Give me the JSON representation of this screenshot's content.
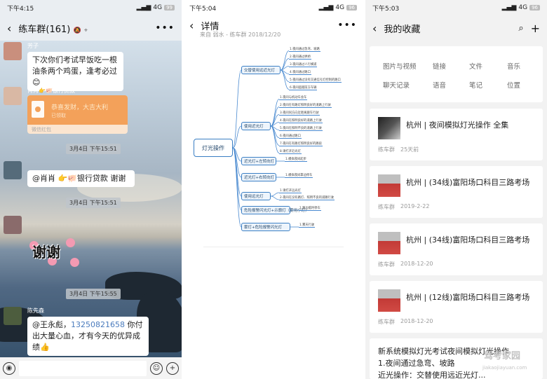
{
  "chat": {
    "status_time": "下午4:15",
    "network": "4G",
    "battery": "99",
    "title": "练车群(161)",
    "messages": [
      {
        "sender": "芳子",
        "text": "下次你们考试早饭吃一根油条两个鸡蛋，逢考必过😊"
      },
      {
        "sender": "肖肖👉🐖银行贷款",
        "red_packet_title": "恭喜发财，大吉大利",
        "red_packet_status": "已领取",
        "red_packet_label": "微信红包"
      },
      {
        "timestamp": "3月4日 下午15:51"
      },
      {
        "sender": "",
        "text": "@肖肖 👉🐖银行贷款  谢谢"
      },
      {
        "timestamp": "3月4日 下午15:51"
      },
      {
        "sender": "",
        "sticker_text": "谢谢"
      },
      {
        "timestamp": "3月4日 下午15:55"
      },
      {
        "sender": "陈先森",
        "mention": "@王永彪，",
        "phone": "13250821658",
        "text": " 你付出大量心血，才有今天的优异成绩👍"
      }
    ],
    "mute_icon": "mute-icon",
    "location_icon": "location-icon"
  },
  "detail": {
    "status_time": "下午5:04",
    "network": "4G",
    "battery": "96",
    "title": "详情",
    "source": "来自 弱水 - 练车群 2018/12/20",
    "mindmap": {
      "root": "灯光操作",
      "branches": [
        {
          "label": "交替使用远近光灯",
          "leaves": [
            "1.夜间通过急弯、坡路",
            "2.夜间通过拱桥",
            "3.夜间通过人行横道",
            "4.夜间通过路口",
            "5.夜间通过没有交通信号灯控制的路口",
            "6.夜间超越前方车辆"
          ]
        },
        {
          "label": "使用近光灯",
          "leaves": [
            "1.夜间与机动车会车",
            "2.夜间在有路灯照明良好的道路上行驶",
            "3.夜间同方向近距离跟车行驶",
            "4.夜间在照明良好的道路上行驶",
            "5.夜间在照明不良的道路上行驶",
            "6.夜间通过路口",
            "7.夜间在有路灯照明良好的路段",
            "8.请打开近光灯"
          ]
        },
        {
          "label": "近光灯+左转向灯",
          "leaves": [
            "1.模拟夜间起步"
          ]
        },
        {
          "label": "近光灯+右转向灯",
          "leaves": [
            "1.模拟夜间靠边停车"
          ]
        },
        {
          "label": "使用远光灯",
          "leaves": [
            "1.请打开远光灯",
            "2.夜间在没有路灯、照明不良的道路行驶"
          ]
        },
        {
          "label": "危险报警闪光灯+示廓灯（雾用小灯）",
          "leaves": [
            "1.路边临时停车"
          ]
        },
        {
          "label": "雾灯+危险报警闪光灯",
          "leaves": [
            "1.雾天行驶"
          ]
        }
      ]
    }
  },
  "favorites": {
    "status_time": "下午5:03",
    "network": "4G",
    "battery": "96",
    "title": "我的收藏",
    "categories": [
      "图片与视频",
      "链接",
      "文件",
      "音乐",
      "聊天记录",
      "语音",
      "笔记",
      "位置"
    ],
    "items": [
      {
        "title": "杭州 | 夜间模拟灯光操作 全集",
        "source": "练车群",
        "date": "25天前"
      },
      {
        "title": "杭州 | (34线)富阳场口科目三路考场",
        "source": "练车群",
        "date": "2019-2-22"
      },
      {
        "title": "杭州 | (34线)富阳场口科目三路考场",
        "source": "练车群",
        "date": "2018-12-20"
      },
      {
        "title": "杭州 | (12线)富阳场口科目三路考场",
        "source": "练车群",
        "date": "2018-12-20"
      }
    ],
    "article_lines": [
      "新系统模拟灯光考试夜间模拟灯光操作",
      "1.夜间通过急弯、坡路",
      "近光操作：交替使用远近光灯..."
    ],
    "watermark": "驾考家园",
    "watermark_url": "jiakaojiayuan.com"
  }
}
